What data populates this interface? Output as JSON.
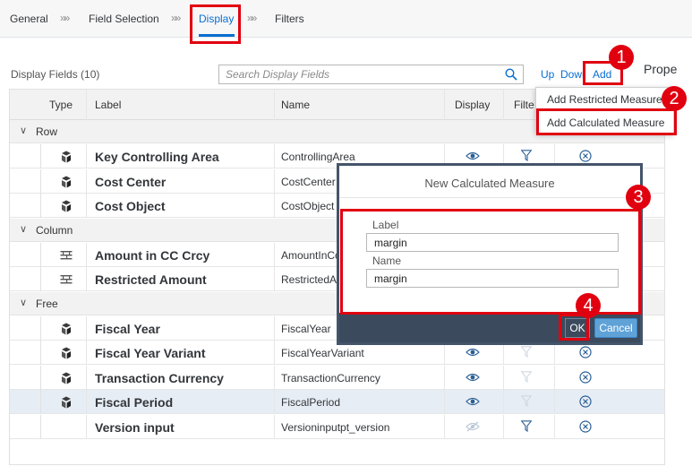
{
  "nav": {
    "steps": [
      "General",
      "Field Selection",
      "Display",
      "Filters"
    ],
    "separator": "»»"
  },
  "toolbar": {
    "title": "Display Fields (10)",
    "search_placeholder": "Search Display Fields",
    "up": "Up",
    "down": "Down",
    "add": "Add",
    "properties_partial": "Prope"
  },
  "table": {
    "headers": {
      "type": "Type",
      "label": "Label",
      "name": "Name",
      "display": "Display",
      "filter": "Filte"
    },
    "groups": [
      {
        "label": "Row"
      },
      {
        "label": "Column"
      },
      {
        "label": "Free"
      }
    ],
    "rows": [
      {
        "label": "Key Controlling Area",
        "name": "ControllingArea",
        "type_icon": "dimension-icon",
        "display": "visible",
        "filter": "active"
      },
      {
        "label": "Cost Center",
        "name": "CostCenter",
        "type_icon": "dimension-icon"
      },
      {
        "label": "Cost Object",
        "name": "CostObject",
        "type_icon": "dimension-icon"
      },
      {
        "label": "Amount in CC Crcy",
        "name": "AmountInCo",
        "type_icon": "measure-icon"
      },
      {
        "label": "Restricted Amount",
        "name": "RestrictedAr",
        "type_icon": "measure-icon"
      },
      {
        "label": "Fiscal Year",
        "name": "FiscalYear",
        "type_icon": "dimension-icon"
      },
      {
        "label": "Fiscal Year Variant",
        "name": "FiscalYearVariant",
        "type_icon": "dimension-icon",
        "display": "visible",
        "filter": "inactive"
      },
      {
        "label": "Transaction Currency",
        "name": "TransactionCurrency",
        "type_icon": "dimension-icon",
        "display": "visible",
        "filter": "inactive"
      },
      {
        "label": "Fiscal Period",
        "name": "FiscalPeriod",
        "type_icon": "dimension-icon",
        "display": "visible",
        "filter": "inactive",
        "selected": true
      },
      {
        "label": "Version input",
        "name": "Versioninputpt_version",
        "type_icon": "none",
        "display": "hidden",
        "filter": "active"
      }
    ]
  },
  "menu": {
    "items": [
      "Add Restricted Measure",
      "Add Calculated Measure"
    ]
  },
  "dialog": {
    "title": "New Calculated Measure",
    "label_caption": "Label",
    "label_value": "margin",
    "name_caption": "Name",
    "name_value": "margin",
    "ok": "OK",
    "cancel": "Cancel"
  },
  "annotations": {
    "badges": [
      "1",
      "2",
      "3",
      "4"
    ],
    "color": "#e1000f"
  },
  "colors": {
    "accent": "#0a6ed1",
    "dialog_frame": "#44546a",
    "cancel_button": "#5fa2d8"
  }
}
